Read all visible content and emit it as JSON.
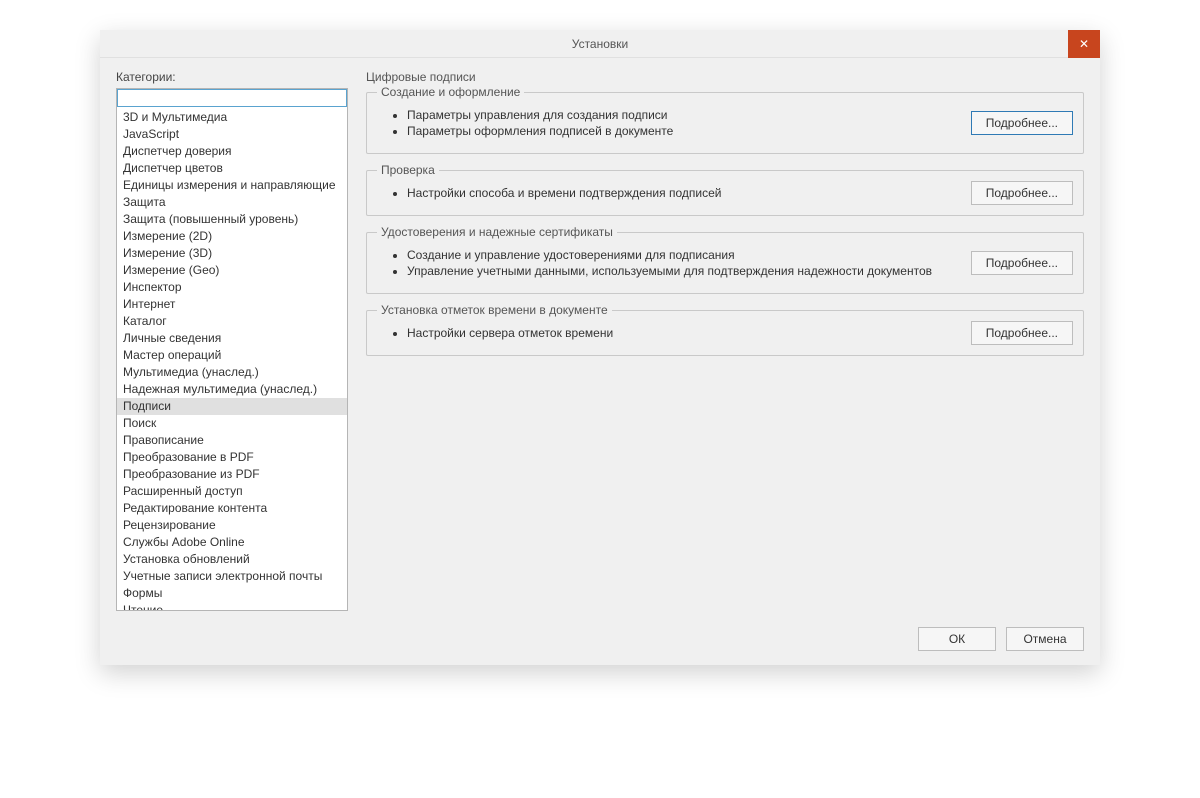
{
  "window": {
    "title": "Установки",
    "close_label": "✕"
  },
  "sidebar": {
    "label": "Категории:",
    "search": {
      "value": ""
    },
    "selected_index": 19,
    "items": [
      "3D и Мультимедиа",
      "JavaScript",
      "Диспетчер доверия",
      "Диспетчер цветов",
      "Единицы измерения и направляющие",
      "Защита",
      "Защита (повышенный уровень)",
      "Измерение (2D)",
      "Измерение (3D)",
      "Измерение (Geo)",
      "Инспектор",
      "Интернет",
      "Каталог",
      "Личные сведения",
      "Мастер операций",
      "Мультимедиа (унаслед.)",
      "Надежная мультимедиа (унаслед.)",
      "Подписи",
      "Поиск",
      "Правописание",
      "Преобразование в PDF",
      "Преобразование из PDF",
      "Расширенный доступ",
      "Редактирование контента",
      "Рецензирование",
      "Службы Adobe Online",
      "Установка обновлений",
      "Учетные записи электронной почты",
      "Формы",
      "Чтение"
    ]
  },
  "content": {
    "heading": "Цифровые подписи",
    "details_button_label": "Подробнее...",
    "sections": [
      {
        "title": "Создание и оформление",
        "bullets": [
          "Параметры управления для создания подписи",
          "Параметры оформления подписей в документе"
        ]
      },
      {
        "title": "Проверка",
        "bullets": [
          "Настройки способа и времени подтверждения подписей"
        ]
      },
      {
        "title": "Удостоверения и надежные сертификаты",
        "bullets": [
          "Создание и управление удостоверениями для подписания",
          "Управление учетными данными, используемыми для подтверждения надежности документов"
        ]
      },
      {
        "title": "Установка отметок времени в документе",
        "bullets": [
          "Настройки сервера отметок времени"
        ]
      }
    ]
  },
  "footer": {
    "ok_label": "ОК",
    "cancel_label": "Отмена"
  }
}
